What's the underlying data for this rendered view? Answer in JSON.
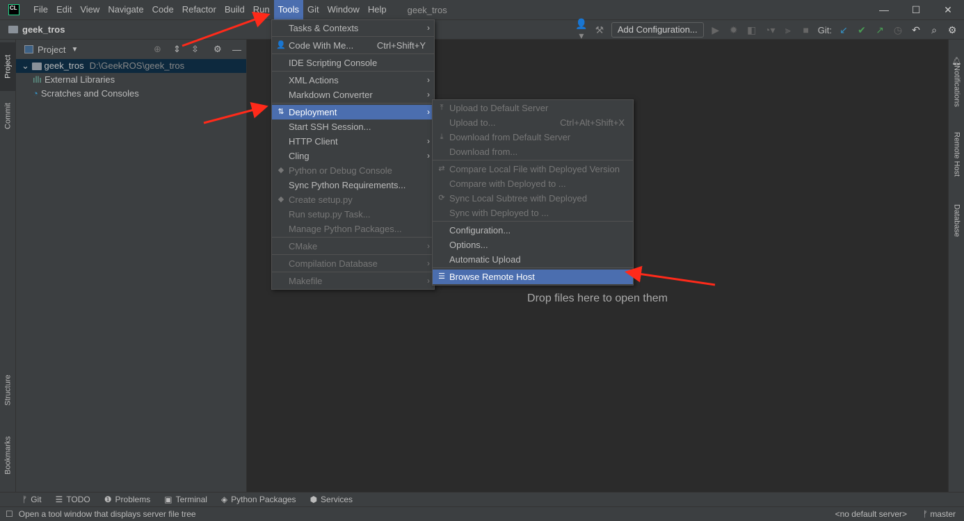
{
  "window": {
    "title": "geek_tros",
    "logo": "CL"
  },
  "menubar": [
    "File",
    "Edit",
    "View",
    "Navigate",
    "Code",
    "Refactor",
    "Build",
    "Run",
    "Tools",
    "Git",
    "Window",
    "Help"
  ],
  "menubar_active": "Tools",
  "navbar": {
    "project": "geek_tros",
    "add_configuration": "Add Configuration...",
    "git_label": "Git:"
  },
  "project_panel": {
    "title": "Project",
    "tree": [
      {
        "label": "geek_tros",
        "path": "D:\\GeekROS\\geek_tros",
        "icon": "folder-icon",
        "selected": true
      },
      {
        "label": "External Libraries",
        "icon": "library-icon"
      },
      {
        "label": "Scratches and Consoles",
        "icon": "scratches-icon"
      }
    ]
  },
  "left_tabs": [
    "Project",
    "Commit",
    "Structure",
    "Bookmarks"
  ],
  "right_tabs": [
    "Notifications",
    "Remote Host",
    "Database"
  ],
  "editor": {
    "empty_text": "Drop files here to open them"
  },
  "tools_menu": [
    {
      "label": "Tasks & Contexts",
      "submenu": true,
      "sep_after": true
    },
    {
      "label": "Code With Me...",
      "shortcut": "Ctrl+Shift+Y",
      "icon": "👤",
      "sep_after": true
    },
    {
      "label": "IDE Scripting Console",
      "sep_after": true
    },
    {
      "label": "XML Actions",
      "submenu": true
    },
    {
      "label": "Markdown Converter",
      "submenu": true,
      "sep_after": true
    },
    {
      "label": "Deployment",
      "submenu": true,
      "icon": "⇅",
      "highlighted": true
    },
    {
      "label": "Start SSH Session..."
    },
    {
      "label": "HTTP Client",
      "submenu": true
    },
    {
      "label": "Cling",
      "submenu": true
    },
    {
      "label": "Python or Debug Console",
      "disabled": true,
      "icon": "◆"
    },
    {
      "label": "Sync Python Requirements..."
    },
    {
      "label": "Create setup.py",
      "disabled": true,
      "icon": "◆"
    },
    {
      "label": "Run setup.py Task...",
      "disabled": true
    },
    {
      "label": "Manage Python Packages...",
      "disabled": true,
      "sep_after": true
    },
    {
      "label": "CMake",
      "submenu": true,
      "disabled": true,
      "sep_after": true
    },
    {
      "label": "Compilation Database",
      "submenu": true,
      "disabled": true,
      "sep_after": true
    },
    {
      "label": "Makefile",
      "submenu": true,
      "disabled": true
    }
  ],
  "deployment_menu": [
    {
      "label": "Upload to Default Server",
      "disabled": true,
      "icon": "⤒"
    },
    {
      "label": "Upload to...",
      "shortcut": "Ctrl+Alt+Shift+X",
      "disabled": true
    },
    {
      "label": "Download from Default Server",
      "disabled": true,
      "icon": "⤓"
    },
    {
      "label": "Download from...",
      "disabled": true,
      "sep_after": true
    },
    {
      "label": "Compare Local File with Deployed Version",
      "disabled": true,
      "icon": "⇄"
    },
    {
      "label": "Compare with Deployed to ...",
      "disabled": true
    },
    {
      "label": "Sync Local Subtree with Deployed",
      "disabled": true,
      "icon": "⟳"
    },
    {
      "label": "Sync with Deployed to ...",
      "disabled": true,
      "sep_after": true
    },
    {
      "label": "Configuration..."
    },
    {
      "label": "Options..."
    },
    {
      "label": "Automatic Upload",
      "sep_after": true
    },
    {
      "label": "Browse Remote Host",
      "icon": "☰",
      "highlighted": true
    }
  ],
  "tool_windows": [
    {
      "label": "Git",
      "icon": "git-branch-icon",
      "glyph": "ᚠ"
    },
    {
      "label": "TODO",
      "icon": "list-icon",
      "glyph": "☰"
    },
    {
      "label": "Problems",
      "icon": "problems-icon",
      "glyph": "❶"
    },
    {
      "label": "Terminal",
      "icon": "terminal-icon",
      "glyph": "▣"
    },
    {
      "label": "Python Packages",
      "icon": "layers-icon",
      "glyph": "◈"
    },
    {
      "label": "Services",
      "icon": "services-icon",
      "glyph": "⬢"
    }
  ],
  "status": {
    "message": "Open a tool window that displays server file tree",
    "server": "<no default server>",
    "branch": "master"
  },
  "colors": {
    "highlight": "#4b6eaf",
    "annotation_arrow": "#ff2a1a",
    "tree_selection": "#0d293e"
  }
}
